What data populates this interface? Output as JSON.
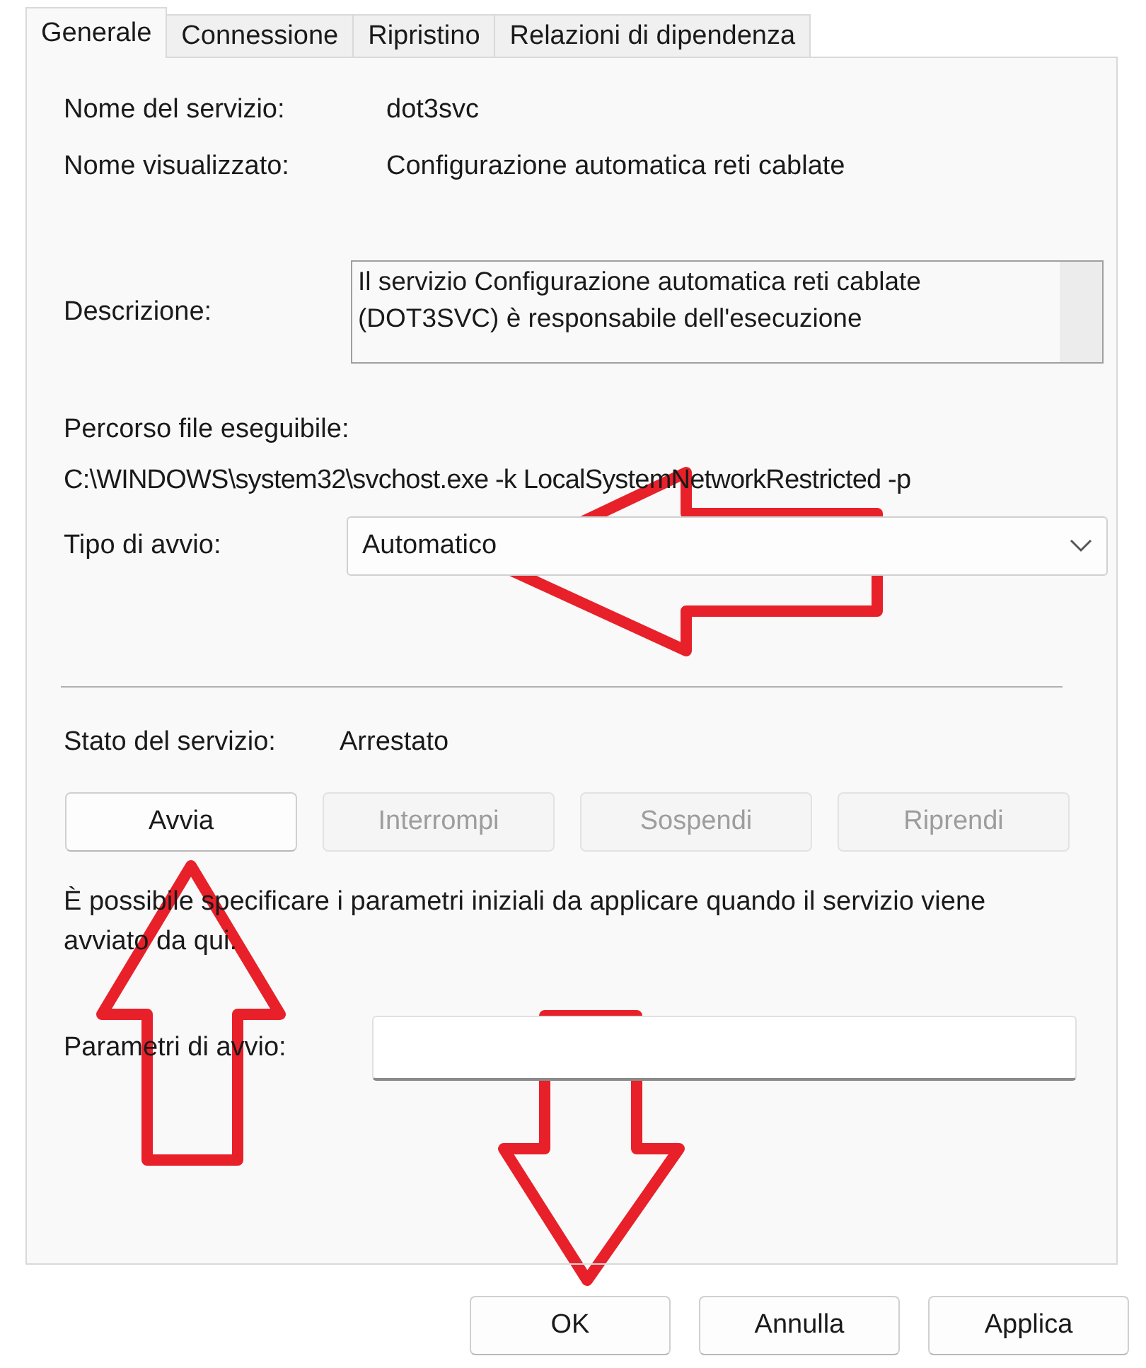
{
  "tabs": [
    {
      "label": "Generale",
      "selected": true
    },
    {
      "label": "Connessione",
      "selected": false
    },
    {
      "label": "Ripristino",
      "selected": false
    },
    {
      "label": "Relazioni di dipendenza",
      "selected": false
    }
  ],
  "service_name": {
    "label": "Nome del servizio:",
    "value": "dot3svc"
  },
  "display_name": {
    "label": "Nome visualizzato:",
    "value": "Configurazione automatica reti cablate"
  },
  "description": {
    "label": "Descrizione:",
    "value": "Il servizio Configurazione automatica reti cablate (DOT3SVC) è responsabile dell'esecuzione"
  },
  "executable_path": {
    "label": "Percorso file eseguibile:",
    "value": "C:\\WINDOWS\\system32\\svchost.exe -k LocalSystemNetworkRestricted -p"
  },
  "startup_type": {
    "label": "Tipo di avvio:",
    "value": "Automatico"
  },
  "service_status": {
    "label": "Stato del servizio:",
    "value": "Arrestato"
  },
  "control_buttons": [
    {
      "label": "Avvia",
      "disabled": false
    },
    {
      "label": "Interrompi",
      "disabled": true
    },
    {
      "label": "Sospendi",
      "disabled": true
    },
    {
      "label": "Riprendi",
      "disabled": true
    }
  ],
  "hint": "È possibile specificare i parametri iniziali da applicare quando il servizio viene avviato da qui.",
  "start_parameters": {
    "label": "Parametri di avvio:"
  },
  "dialog_buttons": [
    {
      "label": "OK"
    },
    {
      "label": "Annulla"
    },
    {
      "label": "Applica"
    }
  ]
}
